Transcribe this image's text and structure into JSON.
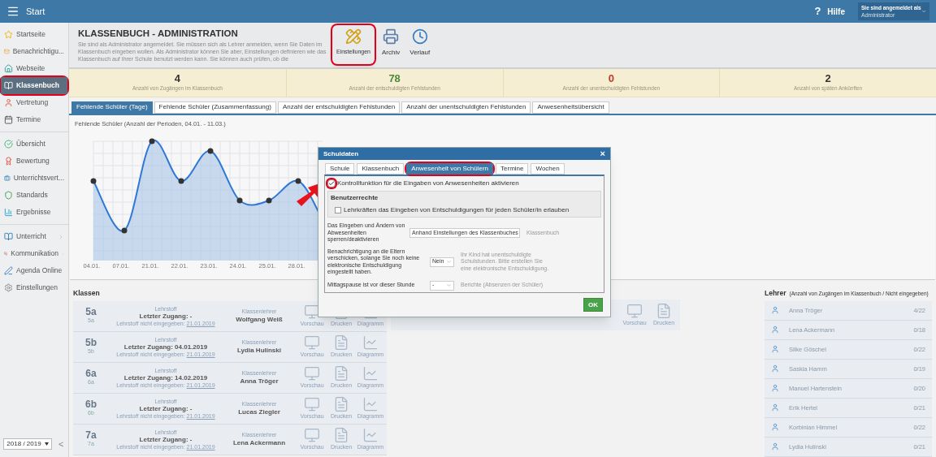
{
  "header": {
    "menu_label": "Start",
    "help": "Hilfe",
    "help_mark": "?",
    "user_caption": "Sie sind angemeldet als",
    "user_name": "Administrator"
  },
  "sidebar": {
    "groups": [
      [
        {
          "label": "Startseite",
          "selected": false,
          "highlighted": false
        },
        {
          "label": "Benachrichtigu...",
          "selected": false,
          "highlighted": false
        },
        {
          "label": "Webseite",
          "selected": false,
          "highlighted": false
        },
        {
          "label": "Klassenbuch",
          "selected": true,
          "highlighted": true
        },
        {
          "label": "Vertretung",
          "selected": false,
          "highlighted": false
        },
        {
          "label": "Termine",
          "selected": false,
          "highlighted": false
        }
      ],
      [
        {
          "label": "Übersicht",
          "selected": false,
          "highlighted": false
        },
        {
          "label": "Bewertung",
          "selected": false,
          "highlighted": false
        },
        {
          "label": "Unterrichtsvert...",
          "selected": false,
          "highlighted": false
        },
        {
          "label": "Standards",
          "selected": false,
          "highlighted": false
        },
        {
          "label": "Ergebnisse",
          "selected": false,
          "highlighted": false
        }
      ],
      [
        {
          "label": "Unterricht",
          "selected": false,
          "highlighted": false,
          "submenu": true
        },
        {
          "label": "Kommunikation",
          "selected": false,
          "highlighted": false,
          "submenu": true
        },
        {
          "label": "Agenda Online",
          "selected": false,
          "highlighted": false
        },
        {
          "label": "Einstellungen",
          "selected": false,
          "highlighted": false
        }
      ]
    ],
    "year": "2018 / 2019",
    "collapse": "<"
  },
  "page": {
    "title": "KLASSENBUCH - ADMINISTRATION",
    "description": "Sie sind als Administrator angemeldet. Sie müssen sich als Lehrer anmelden, wenn Sie Daten im Klassenbuch eingeben wollen. Als Administrator können Sie aber, Einstellungen definieren wie das Klassenbuch auf Ihrer Schule benutzt werden kann. Sie können auch prüfen, ob die",
    "toolbar": [
      {
        "label": "Einstellungen",
        "highlighted": true
      },
      {
        "label": "Archiv",
        "highlighted": false
      },
      {
        "label": "Verlauf",
        "highlighted": false
      }
    ]
  },
  "stats": [
    {
      "value": "4",
      "label": "Anzahl von Zugängen im Klassenbuch",
      "color": "#333333"
    },
    {
      "value": "78",
      "label": "Anzahl der entschuldigten Fehlstunden",
      "color": "#4e8a3a"
    },
    {
      "value": "0",
      "label": "Anzahl der unentschuldigten Fehlstunden",
      "color": "#c0392b"
    },
    {
      "value": "2",
      "label": "Anzahl von späten Ankünften",
      "color": "#333333"
    }
  ],
  "tabs": [
    {
      "label": "Fehlende Schüler (Tage)",
      "selected": true
    },
    {
      "label": "Fehlende Schüler (Zusammenfassung)",
      "selected": false
    },
    {
      "label": "Anzahl der entschuldigten Fehlstunden",
      "selected": false
    },
    {
      "label": "Anzahl der unentschuldigten Fehlstunden",
      "selected": false
    },
    {
      "label": "Anwesenheitsübersicht",
      "selected": false
    }
  ],
  "chart": {
    "title": "Fehlende Schüler (Anzahl der Perioden, 04.01. - 11.03.)",
    "x_labels": [
      "04.01.",
      "07.01.",
      "21.01.",
      "22.01.",
      "23.01.",
      "24.01.",
      "25.01.",
      "28.01."
    ]
  },
  "classes": {
    "title": "Klassen",
    "rows": [
      {
        "name": "5a",
        "sub": "5a",
        "lehrstoff_label": "Lehrstoff",
        "last": "Letzter Zugang: -",
        "missing_label": "Lehrstoff nicht eingegeben:",
        "missing_date": "21.01.2019",
        "teacher_label": "Klassenlehrer",
        "teacher": "Wolfgang Weiß",
        "actions": [
          "Vorschau",
          "Drucken",
          "Diagramm"
        ]
      },
      {
        "name": "5b",
        "sub": "5b",
        "lehrstoff_label": "Lehrstoff",
        "last": "Letzter Zugang: 04.01.2019",
        "missing_label": "Lehrstoff nicht eingegeben:",
        "missing_date": "21.01.2019",
        "teacher_label": "Klassenlehrer",
        "teacher": "Lydia Hulinski",
        "actions": [
          "Vorschau",
          "Drucken",
          "Diagramm"
        ]
      },
      {
        "name": "6a",
        "sub": "6a",
        "lehrstoff_label": "Lehrstoff",
        "last": "Letzter Zugang: 14.02.2019",
        "missing_label": "Lehrstoff nicht eingegeben:",
        "missing_date": "21.01.2019",
        "teacher_label": "Klassenlehrer",
        "teacher": "Anna Tröger",
        "actions": [
          "Vorschau",
          "Drucken",
          "Diagramm"
        ]
      },
      {
        "name": "6b",
        "sub": "6b",
        "lehrstoff_label": "Lehrstoff",
        "last": "Letzter Zugang: -",
        "missing_label": "Lehrstoff nicht eingegeben:",
        "missing_date": "21.01.2019",
        "teacher_label": "Klassenlehrer",
        "teacher": "Lucas Ziegler",
        "actions": [
          "Vorschau",
          "Drucken",
          "Diagramm"
        ]
      },
      {
        "name": "7a",
        "sub": "7a",
        "lehrstoff_label": "Lehrstoff",
        "last": "Letzter Zugang: -",
        "missing_label": "Lehrstoff nicht eingegeben:",
        "missing_date": "21.01.2019",
        "teacher_label": "Klassenlehrer",
        "teacher": "Lena Ackermann",
        "actions": [
          "Vorschau",
          "Drucken",
          "Diagramm"
        ]
      }
    ]
  },
  "middle_card": {
    "actions": [
      "Vorschau",
      "Drucken"
    ]
  },
  "teachers": {
    "title": "Lehrer",
    "subtitle": "(Anzahl von Zugängen im Klassenbuch / Nicht eingegeben)",
    "rows": [
      {
        "name": "Anna Tröger",
        "count": "4/22"
      },
      {
        "name": "Lena Ackermann",
        "count": "0/18"
      },
      {
        "name": "Silke Göschel",
        "count": "0/22"
      },
      {
        "name": "Saskia Hamm",
        "count": "0/19"
      },
      {
        "name": "Manuel Hartenstein",
        "count": "0/20"
      },
      {
        "name": "Erik Hertel",
        "count": "0/21"
      },
      {
        "name": "Korbinian Himmel",
        "count": "0/22"
      },
      {
        "name": "Lydia Hulinski",
        "count": "0/21"
      }
    ]
  },
  "dialog": {
    "title": "Schuldaten",
    "close": "×",
    "tabs": [
      {
        "label": "Schule",
        "selected": false,
        "highlighted": false
      },
      {
        "label": "Klassenbuch",
        "selected": false,
        "highlighted": false
      },
      {
        "label": "Anwesenheit von Schülern",
        "selected": true,
        "highlighted": true
      },
      {
        "label": "Termine",
        "selected": false,
        "highlighted": false
      },
      {
        "label": "Wochen",
        "selected": false,
        "highlighted": false
      }
    ],
    "control": {
      "label": "Kontrollfunktion für die Eingaben von Anwesenheiten aktivieren",
      "checked": true,
      "highlighted": true
    },
    "rights": {
      "title": "Benutzerrechte",
      "label": "Lehrkräften das Eingeben von Entschuldigungen für jeden Schüler/in erlauben",
      "checked": false
    },
    "settings": [
      {
        "label": "Das Eingeben und Ändern von Abwesenheiten sperren/deaktivieren",
        "value": "Anhand Einstellungen des Klassenbuches",
        "note": "Klassenbuch"
      },
      {
        "label": "Benachrichtigung an die Eltern verschicken, solange Sie noch keine elektronische Entschuldigung eingestellt haben.",
        "value": "Nein",
        "note": "Ihr Kind hat unentschuldigte Schulstunden. Bitte erstellen Sie eine elektronische Entschuldigung."
      },
      {
        "label": "Mittagspause ist vor dieser Stunde",
        "value": "-",
        "note": "Berichte (Absenzen der Schüler)"
      }
    ],
    "ok": "OK"
  }
}
